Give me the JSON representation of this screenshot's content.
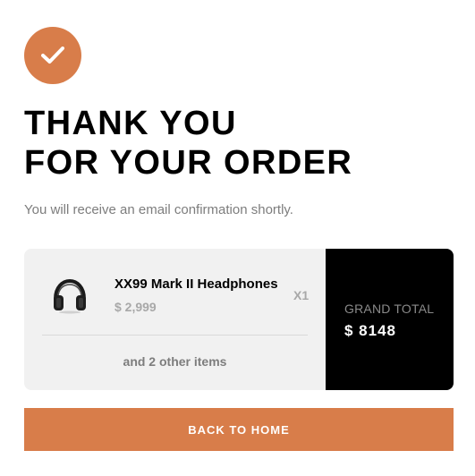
{
  "brand": {
    "accent": "#D87D4A",
    "dark": "#000000",
    "panel": "#F1F1F1"
  },
  "header": {
    "icon": "checkmark-icon",
    "title_line1": "THANK YOU",
    "title_line2": "FOR YOUR ORDER",
    "subtitle": "You will receive an email confirmation shortly."
  },
  "order": {
    "item": {
      "icon": "headphones-icon",
      "name": "XX99 Mark II Headphones",
      "price": "$ 2,999",
      "quantity": "X1"
    },
    "other_items": "and 2 other items",
    "grand_total_label": "GRAND TOTAL",
    "grand_total_value": "$ 8148"
  },
  "actions": {
    "back_home_label": "BACK TO HOME"
  }
}
